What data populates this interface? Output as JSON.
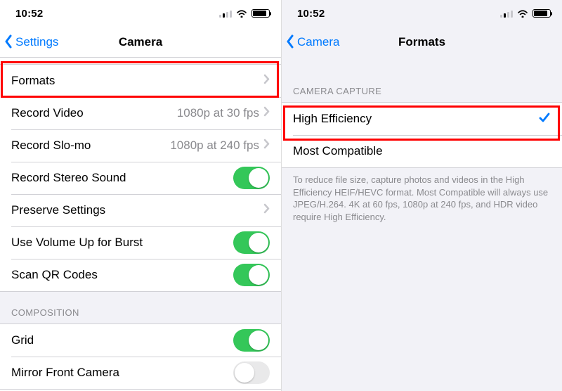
{
  "left": {
    "statusbar": {
      "time": "10:52"
    },
    "nav": {
      "back_label": "Settings",
      "title": "Camera"
    },
    "rows": {
      "formats": {
        "label": "Formats"
      },
      "record_video": {
        "label": "Record Video",
        "detail": "1080p at 30 fps"
      },
      "record_slomo": {
        "label": "Record Slo-mo",
        "detail": "1080p at 240 fps"
      },
      "stereo": {
        "label": "Record Stereo Sound"
      },
      "preserve": {
        "label": "Preserve Settings"
      },
      "volume_burst": {
        "label": "Use Volume Up for Burst"
      },
      "qr": {
        "label": "Scan QR Codes"
      }
    },
    "composition_header": "Composition",
    "composition": {
      "grid": {
        "label": "Grid"
      },
      "mirror": {
        "label": "Mirror Front Camera"
      }
    },
    "toggles": {
      "stereo": true,
      "volume_burst": true,
      "qr": true,
      "grid": true,
      "mirror": false
    }
  },
  "right": {
    "statusbar": {
      "time": "10:52"
    },
    "nav": {
      "back_label": "Camera",
      "title": "Formats"
    },
    "group_header": "Camera Capture",
    "options": {
      "high_efficiency": {
        "label": "High Efficiency",
        "selected": true
      },
      "most_compatible": {
        "label": "Most Compatible",
        "selected": false
      }
    },
    "footer": "To reduce file size, capture photos and videos in the High Efficiency HEIF/HEVC format. Most Compatible will always use JPEG/H.264. 4K at 60 fps, 1080p at 240 fps, and HDR video require High Efficiency."
  }
}
